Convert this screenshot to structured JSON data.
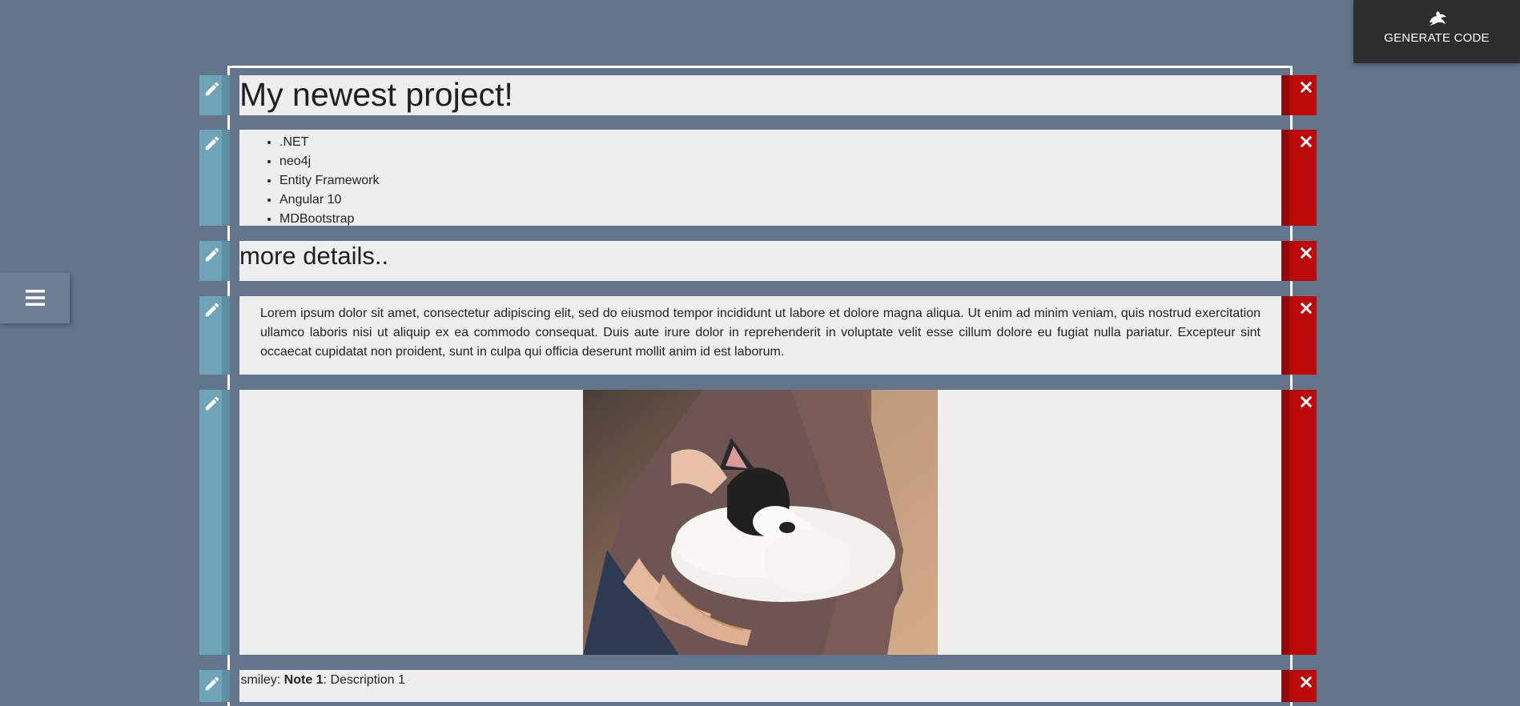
{
  "toolbar": {
    "generate_label": "GENERATE CODE",
    "generate_icon": "dragon-icon",
    "menu_icon": "hamburger-menu-icon"
  },
  "blocks": {
    "title": {
      "text": "My newest project!"
    },
    "techs": {
      "items": [
        ".NET",
        "neo4j",
        "Entity Framework",
        "Angular 10",
        "MDBootstrap"
      ]
    },
    "subtitle": {
      "text": "more details.."
    },
    "paragraph": {
      "text": "Lorem ipsum dolor sit amet, consectetur adipiscing elit, sed do eiusmod tempor incididunt ut labore et dolore magna aliqua. Ut enim ad minim veniam, quis nostrud exercitation ullamco laboris nisi ut aliquip ex ea commodo consequat. Duis aute irure dolor in reprehenderit in voluptate velit esse cillum dolore eu fugiat nulla pariatur. Excepteur sint occaecat cupidatat non proident, sunt in culpa qui officia deserunt mollit anim id est laborum."
    },
    "image": {
      "alt": "Person holding a sleeping French bulldog puppy"
    },
    "note": {
      "prefix": ":smiley: ",
      "bold": "Note 1",
      "suffix": ": Description 1"
    }
  },
  "colors": {
    "background": "#63748d",
    "edit": "#6fa3b7",
    "delete": "#bb0a0a",
    "content": "#eeeeee",
    "generate_button": "#2e2e2e"
  },
  "icons": {
    "edit": "pencil-icon",
    "delete": "close-icon"
  }
}
